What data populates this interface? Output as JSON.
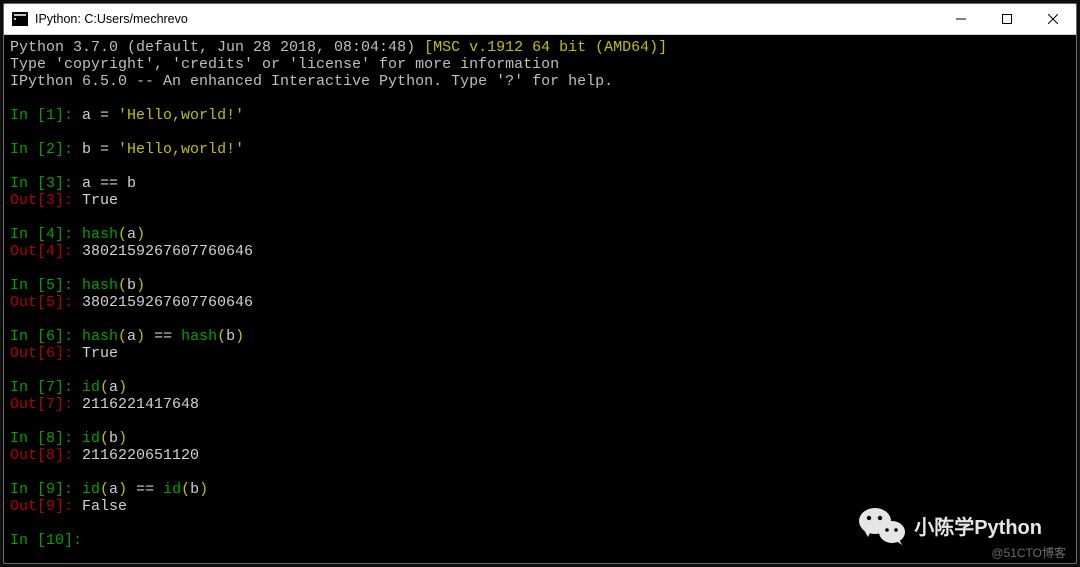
{
  "window": {
    "title": "IPython: C:Users/mechrevo"
  },
  "header": {
    "line1_pre": "Python 3.7.0 (default, Jun 28 2018, 08:04:48) ",
    "line1_br": "[MSC v.1912 64 bit (AMD64)]",
    "line2": "Type 'copyright', 'credits' or 'license' for more information",
    "line3": "IPython 6.5.0 -- An enhanced Interactive Python. Type '?' for help."
  },
  "cells": [
    {
      "in_label": "In [1]: ",
      "code_var": "a ",
      "code_op": "= ",
      "code_str": "'Hello,world!'"
    },
    {
      "in_label": "In [2]: ",
      "code_var": "b ",
      "code_op": "= ",
      "code_str": "'Hello,world!'"
    },
    {
      "in_label": "In [3]: ",
      "code_plain": "a == b",
      "out_label": "Out[3]: ",
      "out_value": "True"
    },
    {
      "in_label": "In [4]: ",
      "fn": "hash",
      "paren_open": "(",
      "arg": "a",
      "paren_close": ")",
      "out_label": "Out[4]: ",
      "out_value": "3802159267607760646"
    },
    {
      "in_label": "In [5]: ",
      "fn": "hash",
      "paren_open": "(",
      "arg": "b",
      "paren_close": ")",
      "out_label": "Out[5]: ",
      "out_value": "3802159267607760646"
    },
    {
      "in_label": "In [6]: ",
      "fn": "hash",
      "paren_open": "(",
      "arg": "a",
      "paren_close": ") ",
      "mid_op": "== ",
      "fn2": "hash",
      "paren2_open": "(",
      "arg2": "b",
      "paren2_close": ")",
      "out_label": "Out[6]: ",
      "out_value": "True"
    },
    {
      "in_label": "In [7]: ",
      "fn": "id",
      "paren_open": "(",
      "arg": "a",
      "paren_close": ")",
      "out_label": "Out[7]: ",
      "out_value": "2116221417648"
    },
    {
      "in_label": "In [8]: ",
      "fn": "id",
      "paren_open": "(",
      "arg": "b",
      "paren_close": ")",
      "out_label": "Out[8]: ",
      "out_value": "2116220651120"
    },
    {
      "in_label": "In [9]: ",
      "fn": "id",
      "paren_open": "(",
      "arg": "a",
      "paren_close": ") ",
      "mid_op": "== ",
      "fn2": "id",
      "paren2_open": "(",
      "arg2": "b",
      "paren2_close": ")",
      "out_label": "Out[9]: ",
      "out_value": "False"
    },
    {
      "in_label": "In [10]: "
    }
  ],
  "watermark": {
    "wechat_label": "小陈学Python",
    "blog_label": "@51CTO博客"
  }
}
